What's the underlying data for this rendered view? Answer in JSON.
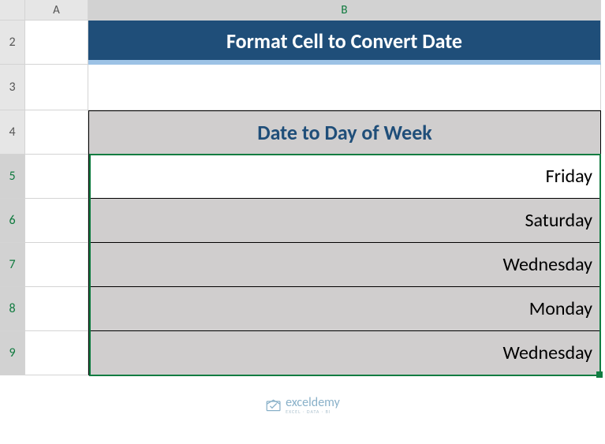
{
  "columns": {
    "A": "A",
    "B": "B"
  },
  "rows": [
    "2",
    "3",
    "4",
    "5",
    "6",
    "7",
    "8",
    "9"
  ],
  "title": "Format Cell to Convert Date",
  "table_header": "Date to Day of Week",
  "days": [
    "Friday",
    "Saturday",
    "Wednesday",
    "Monday",
    "Wednesday"
  ],
  "watermark": {
    "main": "exceldemy",
    "sub": "EXCEL · DATA · BI"
  },
  "chart_data": {
    "type": "table",
    "title": "Date to Day of Week",
    "categories": [
      "B5",
      "B6",
      "B7",
      "B8",
      "B9"
    ],
    "values": [
      "Friday",
      "Saturday",
      "Wednesday",
      "Monday",
      "Wednesday"
    ]
  }
}
